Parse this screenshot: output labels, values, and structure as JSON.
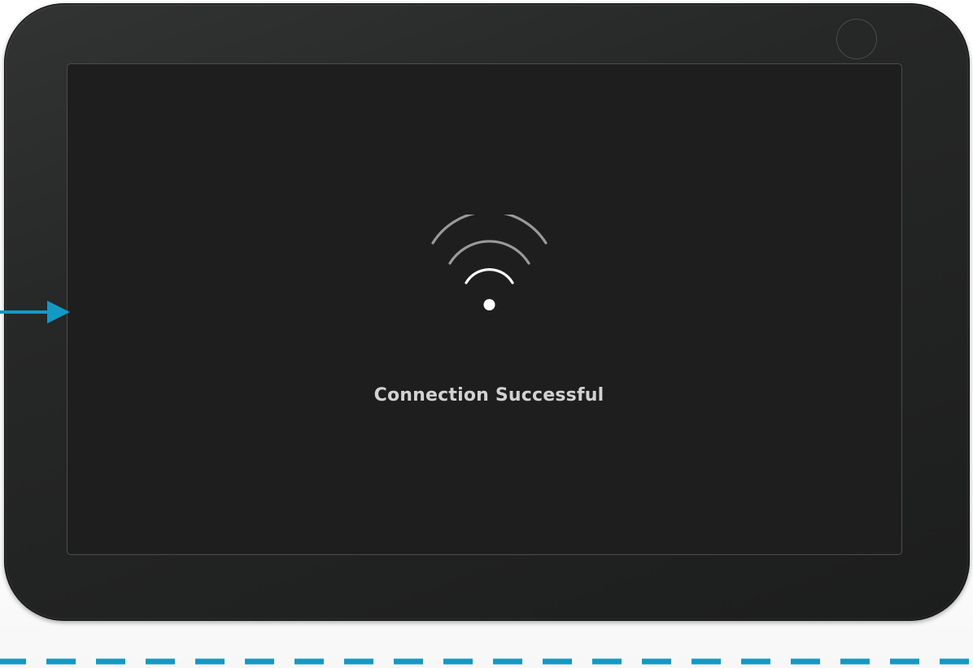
{
  "screen": {
    "status_message": "Connection Successful"
  },
  "icons": {
    "wifi": "wifi-connected-icon",
    "camera": "camera-lens-icon",
    "arrow": "arrow-right-icon"
  },
  "colors": {
    "device_body": "#262727",
    "screen_background": "#1e1e1e",
    "status_text": "#d2d2d2",
    "accent": "#1399c6",
    "wifi_strong": "#ffffff",
    "wifi_dim": "#9a9a9a"
  }
}
